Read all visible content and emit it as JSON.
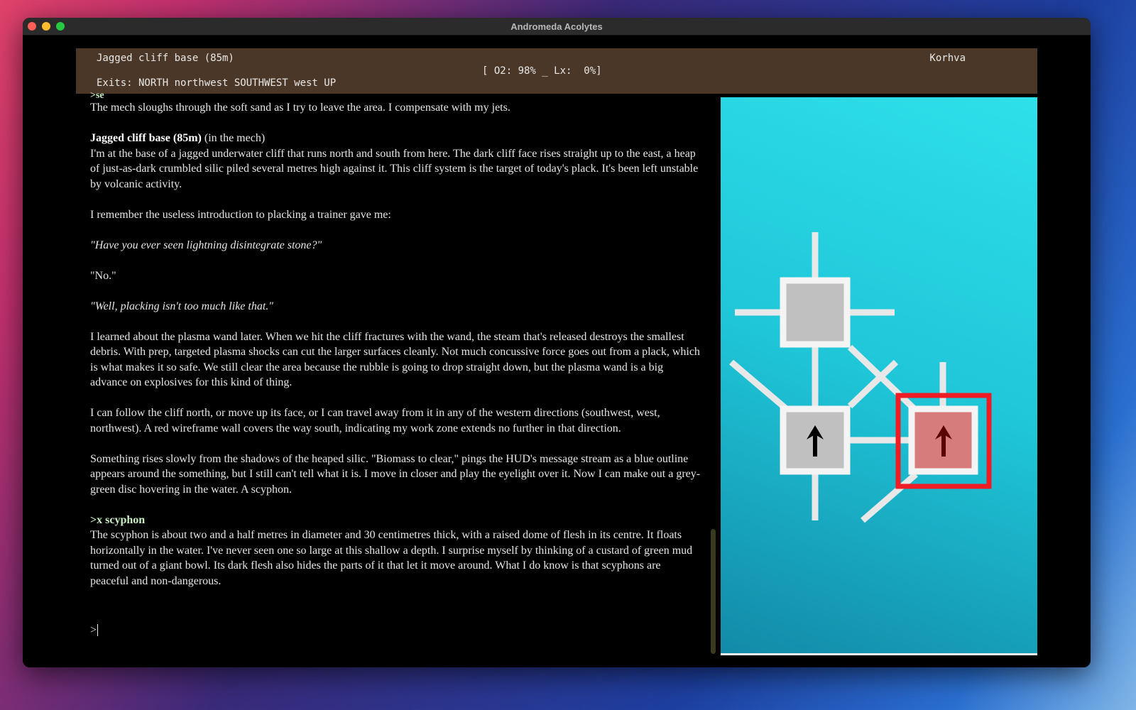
{
  "window": {
    "title": "Andromeda Acolytes"
  },
  "status": {
    "location": "Jagged cliff base (85m)",
    "exits": "Exits: NORTH northwest SOUTHWEST west UP",
    "readout": "[ O2: 98% _ Lx:  0%]",
    "character": "Korhva"
  },
  "story": {
    "cmd1": ">se",
    "p1": "The mech sloughs through the soft sand as I try to leave the area. I compensate with my jets.",
    "room_title": "Jagged cliff base (85m)",
    "room_suffix": " (in the mech)",
    "p2": "I'm at the base of a jagged underwater cliff that runs north and south from here. The dark cliff face rises straight up to the east, a heap of just-as-dark crumbled silic piled several metres high against it. This cliff system is the target of today's plack. It's been left unstable by volcanic activity.",
    "p3": "I remember the useless introduction to placking a trainer gave me:",
    "p4": "\"Have you ever seen lightning disintegrate stone?\"",
    "p5": "\"No.\"",
    "p6": "\"Well, placking isn't too much like that.\"",
    "p7": "I learned about the plasma wand later. When we hit the cliff fractures with the wand, the steam that's released destroys the smallest debris. With prep, targeted plasma shocks can cut the larger surfaces cleanly. Not much concussive force goes out from a plack, which is what makes it so safe. We still clear the area because the rubble is going to drop straight down, but the plasma wand is a big advance on explosives for this kind of thing.",
    "p8": "I can follow the cliff north, or move up its face, or I can travel away from it in any of the western directions (southwest, west, northwest). A red wireframe wall covers the way south, indicating my work zone extends no further in that direction.",
    "p9": "Something rises slowly from the shadows of the heaped silic. \"Biomass to clear,\" pings the HUD's message stream as a blue outline appears around the something, but I still can't tell what it is. I move in closer and play the eyelight over it. Now I can make out a grey-green disc hovering in the water. A scyphon.",
    "cmd2": ">x scyphon",
    "p10": "The scyphon is about two and a half metres in diameter and 30 centimetres thick, with a raised dome of flesh in its centre. It floats horizontally in the water. I've never seen one so large at this shallow a depth. I surprise myself by thinking of a custard of green mud turned out of a giant bowl. Its dark flesh also hides the parts of it that let it move around. What I do know is that scyphons are peaceful and non-dangerous.",
    "prompt": ">"
  },
  "map": {
    "current_room_color": "#d67c7c",
    "room_color": "#c0c0c0",
    "highlight_color": "#ee1c24",
    "icons": [
      "up-arrow-icon",
      "up-arrow-icon"
    ]
  }
}
